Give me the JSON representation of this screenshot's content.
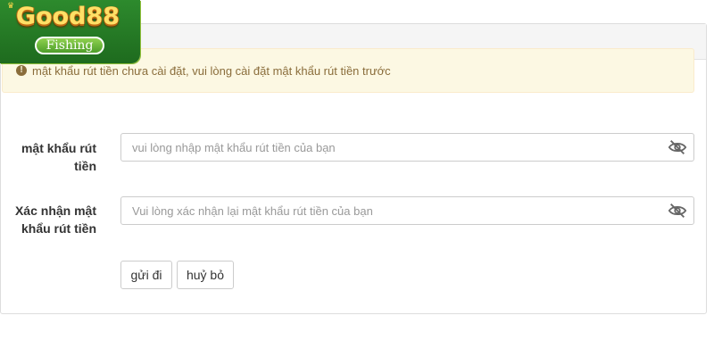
{
  "brand": {
    "logo_text": "Good88",
    "logo_subtext": "Fishing"
  },
  "alert": {
    "icon": "exclamation-circle-icon",
    "message": "mật khẩu rút tiền chưa cài đặt, vui lòng cài đặt mật khẩu rút tiền trước"
  },
  "form": {
    "password": {
      "label_line1": "mật khẩu rút",
      "label_line2": "tiền",
      "value": "",
      "placeholder": "vui lòng nhập mật khẩu rút tiền của bạn",
      "toggle_icon": "eye-slash-icon"
    },
    "confirm": {
      "label_line1": "Xác nhận mật",
      "label_line2": "khẩu rút tiền",
      "value": "",
      "placeholder": "Vui lòng xác nhận lại mật khẩu rút tiền của bạn",
      "toggle_icon": "eye-slash-icon"
    },
    "submit_label": "gửi đi",
    "cancel_label": "huỷ bỏ"
  },
  "colors": {
    "alert_bg": "#fcf8e3",
    "alert_text": "#8a6d3b",
    "logo_green": "#2d8a2d",
    "logo_gold": "#ffe066"
  }
}
